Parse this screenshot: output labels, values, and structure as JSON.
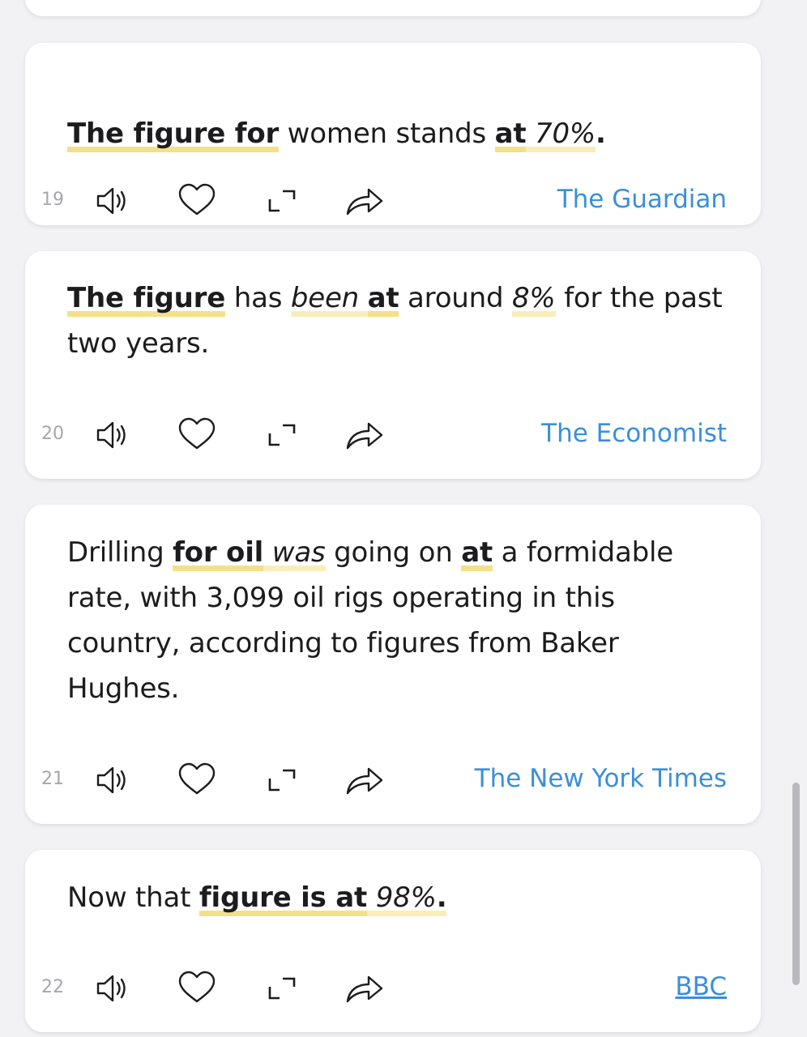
{
  "cards": [
    {
      "number": "19",
      "source": "The Guardian",
      "segments": [
        {
          "t": "The figure for",
          "s": "b hl"
        },
        {
          "t": " women stands ",
          "s": ""
        },
        {
          "t": "at",
          "s": "b hl"
        },
        {
          "t": " ",
          "s": "hl2"
        },
        {
          "t": "70%",
          "s": "i hl2"
        },
        {
          "t": ".",
          "s": "b"
        }
      ]
    },
    {
      "number": "20",
      "source": "The Economist",
      "segments": [
        {
          "t": "The figure",
          "s": "b hl"
        },
        {
          "t": " has ",
          "s": ""
        },
        {
          "t": "been",
          "s": "i hl2"
        },
        {
          "t": " ",
          "s": "hl2"
        },
        {
          "t": "at",
          "s": "b hl"
        },
        {
          "t": " around ",
          "s": ""
        },
        {
          "t": "8%",
          "s": "i hl2"
        },
        {
          "t": " for the past two years.",
          "s": ""
        }
      ]
    },
    {
      "number": "21",
      "source": "The New York Times",
      "segments": [
        {
          "t": "Drilling ",
          "s": ""
        },
        {
          "t": "for oil",
          "s": "b hl"
        },
        {
          "t": " ",
          "s": "hl2"
        },
        {
          "t": "was",
          "s": "i hl2"
        },
        {
          "t": " going on ",
          "s": ""
        },
        {
          "t": "at",
          "s": "b hl"
        },
        {
          "t": " a formidable rate, with 3,099 oil rigs operating in this country, according to figures from Baker Hughes.",
          "s": ""
        }
      ]
    },
    {
      "number": "22",
      "source": "BBC",
      "segments": [
        {
          "t": "Now that ",
          "s": ""
        },
        {
          "t": "figure is at",
          "s": "b hl"
        },
        {
          "t": " ",
          "s": "hl2"
        },
        {
          "t": "98%",
          "s": "i hl2"
        },
        {
          "t": ".",
          "s": "b hl2"
        }
      ]
    }
  ],
  "icons": {
    "speaker": "speaker-icon",
    "heart": "heart-icon",
    "expand": "expand-icon",
    "share": "share-icon"
  },
  "colors": {
    "source_link": "#3b8fd9",
    "highlight_strong": "#f4e08a",
    "highlight_soft": "#f9eeb9",
    "card_bg": "#ffffff",
    "page_bg": "#f2f2f4"
  }
}
